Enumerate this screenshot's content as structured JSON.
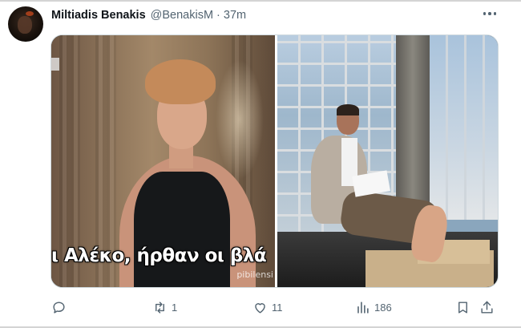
{
  "tweet": {
    "author_name": "Miltiadis Benakis",
    "author_handle": "@BenakisM",
    "separator": "·",
    "time_ago": "37m"
  },
  "media": {
    "left_caption": "ι Αλέκο, ήρθαν οι βλά",
    "left_watermark": "pibilensi"
  },
  "actions": {
    "reply_count": "",
    "retweet_count": "1",
    "like_count": "11",
    "view_count": "186"
  },
  "icons": {
    "more": "more-horizontal-icon",
    "reply": "reply-icon",
    "retweet": "retweet-icon",
    "like": "heart-icon",
    "views": "bar-chart-icon",
    "bookmark": "bookmark-icon",
    "share": "share-icon"
  },
  "colors": {
    "text_primary": "#0f1419",
    "text_secondary": "#536471",
    "media_border": "#cfd9de"
  }
}
